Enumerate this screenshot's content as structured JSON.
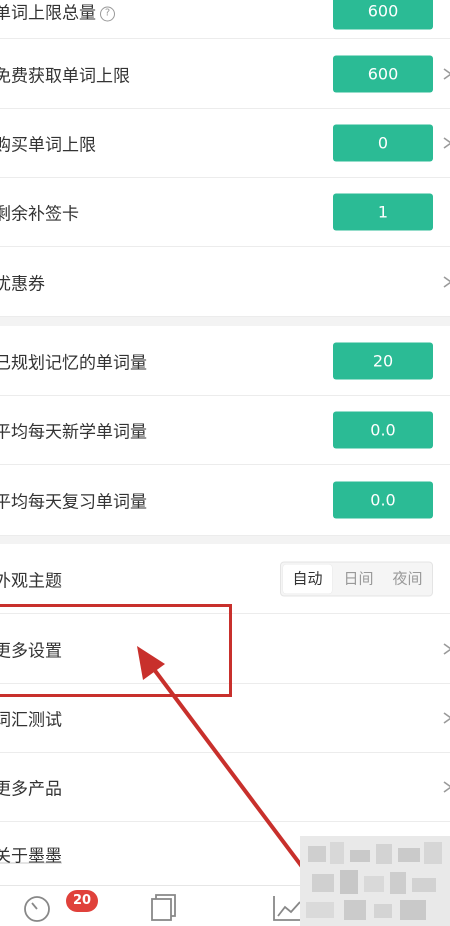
{
  "settings_rows": [
    {
      "label": "单词上限总量",
      "value": "600",
      "has_help": true
    },
    {
      "label": "免费获取单词上限",
      "value": "600"
    },
    {
      "label": "购买单词上限",
      "value": "0"
    },
    {
      "label": "剩余补签卡",
      "value": "1"
    },
    {
      "label": "优惠券"
    }
  ],
  "stats_rows": [
    {
      "label": "已规划记忆的单词量",
      "value": "20"
    },
    {
      "label": "平均每天新学单词量",
      "value": "0.0"
    },
    {
      "label": "平均每天复习单词量",
      "value": "0.0"
    }
  ],
  "theme": {
    "label": "外观主题",
    "options": [
      "自动",
      "日间",
      "夜间"
    ],
    "selected": "自动"
  },
  "menu_rows": [
    {
      "label": "更多设置"
    },
    {
      "label": "词汇测试"
    },
    {
      "label": "更多产品"
    },
    {
      "label": "关于墨墨"
    }
  ],
  "tabbar": {
    "badge_count": "20",
    "icons": [
      "timer-icon",
      "cards-icon",
      "chart-icon"
    ]
  },
  "colors": {
    "accent": "#2bbb95",
    "annotation": "#c8302c",
    "badge": "#e0413b"
  }
}
